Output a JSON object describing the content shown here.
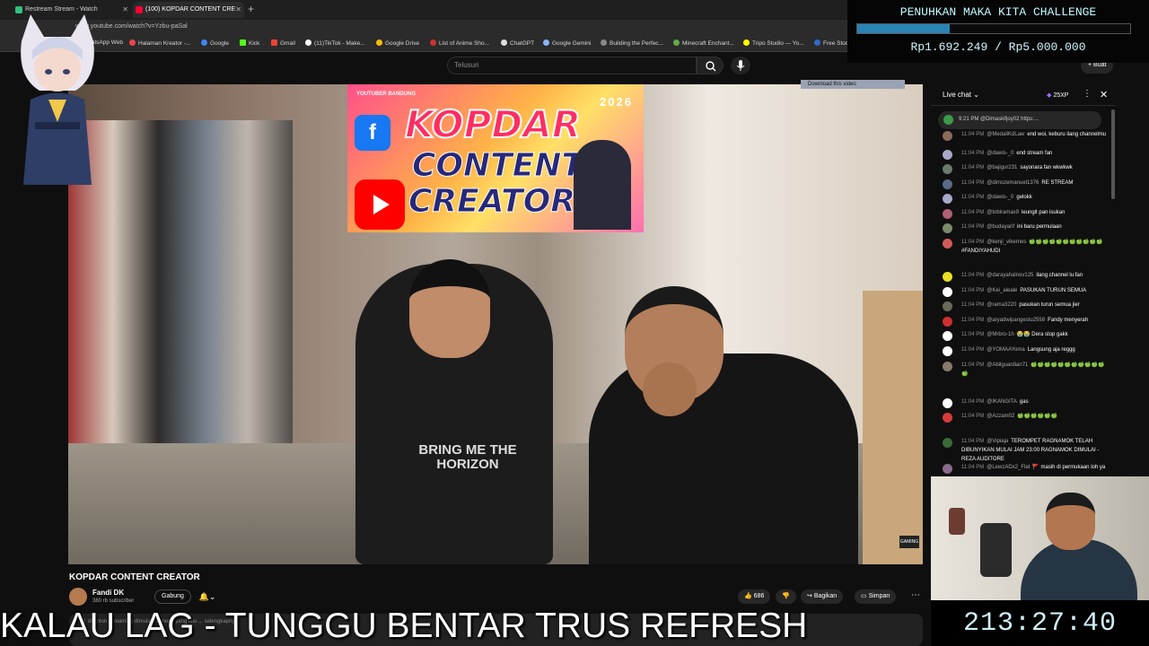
{
  "browser": {
    "tabs": [
      {
        "label": "Restream Stream - Watch",
        "active": false
      },
      {
        "label": "(100) KOPDAR CONTENT CRE",
        "active": true
      }
    ],
    "url": "www.youtube.com/watch?v=Yzbu-paSal",
    "bookmarks": [
      "WhatsApp Web",
      "Halaman Kreator -...",
      "Google",
      "Kick",
      "Gmail",
      "(11)TikTok - Make...",
      "Google Drive",
      "List of Anime Sho...",
      "ChatGPT",
      "Google Gemini",
      "Building the Perfec...",
      "Minecraft Enchant...",
      "Tripo Studio — Yo...",
      "Free Stock"
    ]
  },
  "youtube": {
    "search_placeholder": "Telusuri",
    "create_label": "Buat",
    "download_bar": "Download this video"
  },
  "video": {
    "banner_tag": "YOUTUBER BANDUNG",
    "banner_year": "2026",
    "banner_line1": "KOPDAR",
    "banner_line2": "CONTENT",
    "banner_line3": "CREATOR",
    "shirt_text": "BRING ME THE HORIZON",
    "corner_logo": "GAMING",
    "title": "KOPDAR CONTENT CREATOR",
    "channel_name": "Fandi DK",
    "channel_subs": "380 rb subscriber",
    "join_label": "Gabung",
    "like_count": "686",
    "share_label": "Bagikan",
    "save_label": "Simpan",
    "desc_snippet": "11 ditonton  Streaming dimulai 99 menit yang lalu ... selengkapnya"
  },
  "overlay_message": "KALAU LAG - TUNGGU BENTAR TRUS REFRESH",
  "challenge": {
    "title": "PENUHKAN MAKA KITA CHALLENGE",
    "amount": "Rp1.692.249 / Rp5.000.000",
    "progress": 0.338
  },
  "chat": {
    "title": "Live chat",
    "xp": "25XP",
    "pinned": "9:21 PM  @Dimaskifjoy02  https:...",
    "messages": [
      {
        "time": "11:04 PM",
        "author": "@MedaliKdLaw",
        "text": "end woi, keburu ilang channelmu",
        "color": "#8a6a5a"
      },
      {
        "time": "11:04 PM",
        "author": "@dawis-_0",
        "text": "end stream fan",
        "color": "#a8a8c8"
      },
      {
        "time": "11:04 PM",
        "author": "@bajigur231",
        "text": "sayonara fan wkwkwk",
        "color": "#6a7a6a"
      },
      {
        "time": "11:04 PM",
        "author": "@dimszemanuel1376",
        "text": "RE STREAM",
        "color": "#5a6a8a"
      },
      {
        "time": "11:04 PM",
        "author": "@dawis-_0",
        "text": "gelokk",
        "color": "#a8a8c8"
      },
      {
        "time": "11:04 PM",
        "author": "@tobiramax9",
        "text": "leungit pan isukan",
        "color": "#b06070"
      },
      {
        "time": "11:04 PM",
        "author": "@budayarif",
        "text": "ini baru permulaan",
        "color": "#7a8a6a"
      },
      {
        "time": "11:04 PM",
        "author": "@kenji_vikernes",
        "text": "🍏🍏🍏🍏🍏🍏🍏🍏🍏🍏🍏 #FANDIYAHUDI",
        "color": "#d05a5a"
      },
      {
        "time": "11:04 PM",
        "author": "@darayahalnov125",
        "text": "ilang channel lu fan",
        "color": "#e8e020"
      },
      {
        "time": "11:04 PM",
        "author": "@Kei_aleale",
        "text": "PASUKAN TURUN SEMUA",
        "color": "#ffffff"
      },
      {
        "time": "11:04 PM",
        "author": "@rama3220",
        "text": "pasukan turun semua jier",
        "color": "#6a6a5a"
      },
      {
        "time": "11:04 PM",
        "author": "@aryadwipangestu2558",
        "text": "Fandy menyerah",
        "color": "#d03030"
      },
      {
        "time": "11:04 PM",
        "author": "@Mrbro-1h",
        "text": "😭😭 Dera stop gakk",
        "color": "#ffffff"
      },
      {
        "time": "11:04 PM",
        "author": "@YOMAAYoma",
        "text": "Langsung aja reggg",
        "color": "#ffffff"
      },
      {
        "time": "11:04 PM",
        "author": "@Abilguardian71",
        "text": "🍏🍏🍏🍏🍏🍏🍏🍏🍏🍏🍏🍏",
        "color": "#8a7a6a"
      },
      {
        "time": "11:04 PM",
        "author": "@IKANGITA",
        "text": "gas",
        "color": "#ffffff"
      },
      {
        "time": "11:04 PM",
        "author": "@Azzam02",
        "text": "🍏🍏🍏🍏🍏🍏",
        "color": "#d83a3a"
      },
      {
        "time": "11:04 PM",
        "author": "@Vipiaja",
        "text": "TEROMPET RAGNAMOK TELAH DIBUNYIKAN MULAI JAM 23:00 RAGNAMOK DIMULAI -REZA AUDITORE",
        "color": "#3a6a3a"
      },
      {
        "time": "11:04 PM",
        "author": "@LewzADx2_Flat",
        "text": "🚩 masih di permukaan loh ya",
        "color": "#8a6a8a"
      }
    ]
  },
  "timer": "213:27:40",
  "colors": {
    "accent": "#2b82b5",
    "overlay_text": "#cfeef5"
  }
}
